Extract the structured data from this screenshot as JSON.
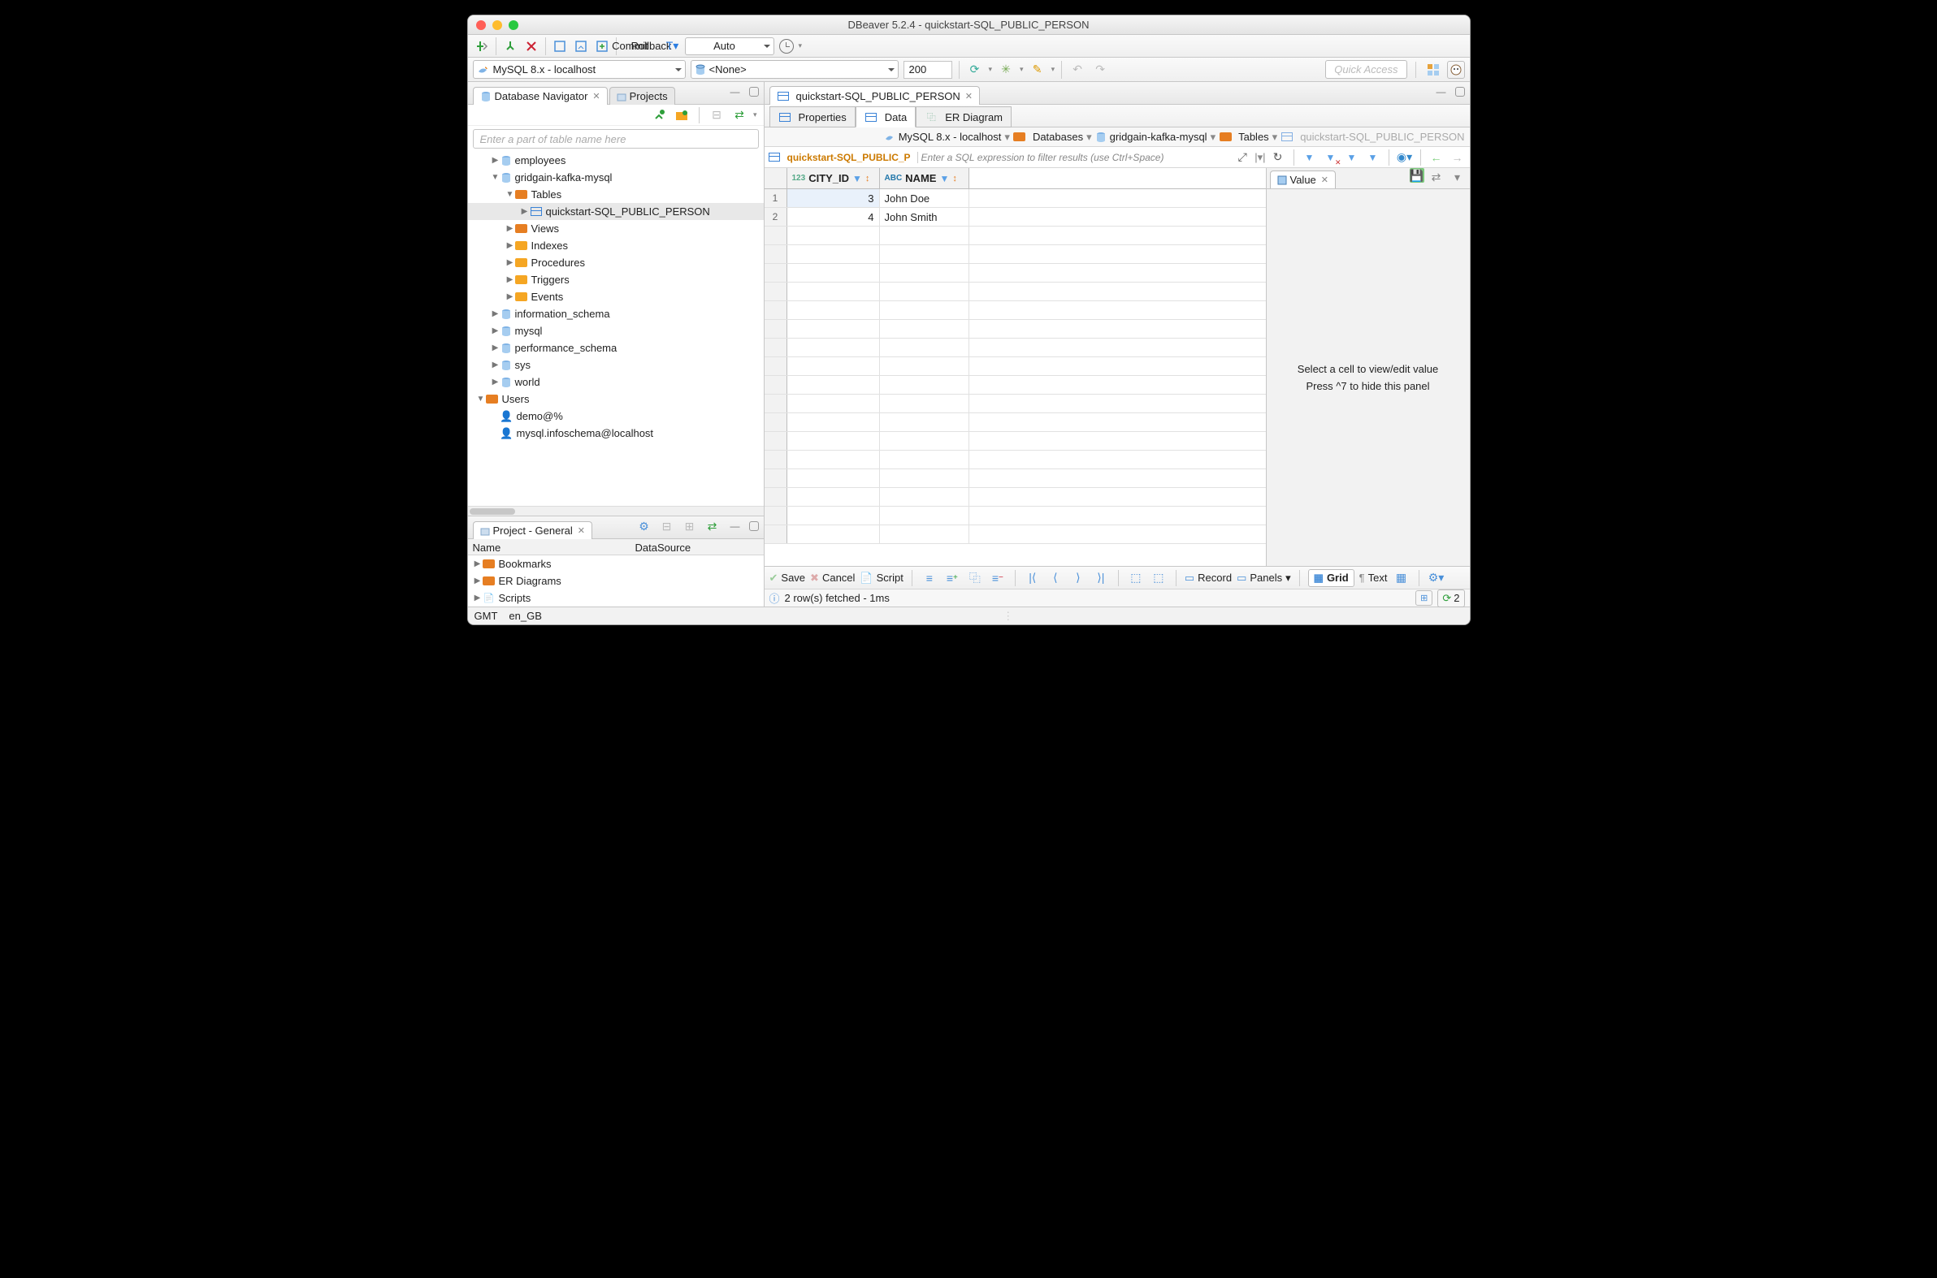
{
  "window_title": "DBeaver 5.2.4 - quickstart-SQL_PUBLIC_PERSON",
  "toolbar": {
    "commit": "Commit",
    "rollback": "Rollback",
    "txmode": "Auto"
  },
  "toolbar2": {
    "conn_label": "MySQL 8.x - localhost",
    "schema_label": "<None>",
    "limit": "200",
    "quick_access": "Quick Access"
  },
  "nav": {
    "view_tab": "Database Navigator",
    "projects_tab": "Projects",
    "search_placeholder": "Enter a part of table name here",
    "tree": {
      "employees": "employees",
      "gridgain": "gridgain-kafka-mysql",
      "tables": "Tables",
      "quickstart_table": "quickstart-SQL_PUBLIC_PERSON",
      "views": "Views",
      "indexes": "Indexes",
      "procedures": "Procedures",
      "triggers": "Triggers",
      "events": "Events",
      "info_schema": "information_schema",
      "mysql": "mysql",
      "perf_schema": "performance_schema",
      "sys": "sys",
      "world": "world",
      "users": "Users",
      "user_demo": "demo@%",
      "user_infoschema": "mysql.infoschema@localhost"
    }
  },
  "project_panel": {
    "title": "Project - General",
    "name_hdr": "Name",
    "ds_hdr": "DataSource",
    "bookmarks": "Bookmarks",
    "er": "ER Diagrams",
    "scripts": "Scripts"
  },
  "editor": {
    "tab": "quickstart-SQL_PUBLIC_PERSON",
    "subtabs": {
      "props": "Properties",
      "data": "Data",
      "er": "ER Diagram"
    },
    "crumbs": {
      "conn": "MySQL 8.x - localhost",
      "databases": "Databases",
      "db": "gridgain-kafka-mysql",
      "tables": "Tables",
      "table": "quickstart-SQL_PUBLIC_PERSON"
    },
    "filter_name": "quickstart-SQL_PUBLIC_P",
    "filter_hint": "Enter a SQL expression to filter results (use Ctrl+Space)"
  },
  "grid": {
    "columns": [
      {
        "name": "CITY_ID",
        "type": "123"
      },
      {
        "name": "NAME",
        "type": "ABC"
      }
    ],
    "rows": [
      {
        "n": "1",
        "city_id": "3",
        "name": "John Doe"
      },
      {
        "n": "2",
        "city_id": "4",
        "name": "John Smith"
      }
    ]
  },
  "value_panel": {
    "tab": "Value",
    "hint1": "Select a cell to view/edit value",
    "hint2": "Press ^7 to hide this panel"
  },
  "grid_status": {
    "save": "Save",
    "cancel": "Cancel",
    "script": "Script",
    "record": "Record",
    "panels": "Panels",
    "grid": "Grid",
    "text": "Text"
  },
  "fetch_status": "2 row(s) fetched - 1ms",
  "refresh_count": "2",
  "status": {
    "tz": "GMT",
    "locale": "en_GB"
  }
}
